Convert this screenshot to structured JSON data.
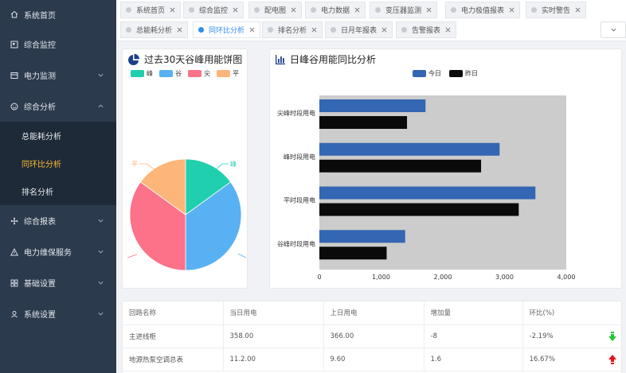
{
  "sidebar": {
    "items": [
      {
        "label": "系统首页",
        "icon": "home-icon"
      },
      {
        "label": "综合监控",
        "icon": "grid-icon"
      },
      {
        "label": "电力监测",
        "icon": "monitor-icon"
      },
      {
        "label": "综合分析",
        "icon": "smile-icon"
      },
      {
        "label": "综合报表",
        "icon": "move-icon"
      },
      {
        "label": "电力维保服务",
        "icon": "warning-icon"
      },
      {
        "label": "基础设置",
        "icon": "apps-icon"
      },
      {
        "label": "系统设置",
        "icon": "user-icon"
      }
    ],
    "sub_items": [
      {
        "label": "总能耗分析"
      },
      {
        "label": "同环比分析"
      },
      {
        "label": "排名分析"
      }
    ]
  },
  "tabs": [
    {
      "label": "系统首页"
    },
    {
      "label": "综合监控"
    },
    {
      "label": "配电图"
    },
    {
      "label": "电力数据"
    },
    {
      "label": "变压器监测"
    },
    {
      "label": "电力极值报表"
    },
    {
      "label": "实时警告"
    },
    {
      "label": "总能耗分析"
    },
    {
      "label": "同环比分析"
    },
    {
      "label": "排名分析"
    },
    {
      "label": "日月年报表"
    },
    {
      "label": "告警报表"
    }
  ],
  "pie_card": {
    "title": "过去30天谷峰用能饼图",
    "legend": [
      {
        "name": "峰",
        "color": "#20cfae"
      },
      {
        "name": "谷",
        "color": "#58b1f2"
      },
      {
        "name": "尖",
        "color": "#fb7289"
      },
      {
        "name": "平",
        "color": "#fdb67a"
      }
    ],
    "labels": {
      "feng": "峰",
      "ping": "平"
    }
  },
  "bar_card": {
    "title": "日峰谷用能同比分析",
    "legend": [
      {
        "name": "今日",
        "color": "#3366b3"
      },
      {
        "name": "昨日",
        "color": "#0a0a0a"
      }
    ]
  },
  "chart_data": [
    {
      "type": "pie",
      "categories": [
        "峰",
        "谷",
        "尖",
        "平"
      ],
      "values": [
        15,
        35,
        35,
        15
      ],
      "colors": [
        "#20cfae",
        "#58b1f2",
        "#fb7289",
        "#fdb67a"
      ]
    },
    {
      "type": "bar",
      "orientation": "horizontal",
      "categories": [
        "尖峰时段用电",
        "峰时段用电",
        "平时段用电",
        "谷峰时段用电"
      ],
      "series": [
        {
          "name": "今日",
          "values": [
            1720,
            2920,
            3500,
            1390
          ],
          "color": "#3366b3"
        },
        {
          "name": "昨日",
          "values": [
            1420,
            2620,
            3230,
            1090
          ],
          "color": "#0a0a0a"
        }
      ],
      "xlim": [
        0,
        4000
      ],
      "xticks": [
        "0",
        "1,000",
        "2,000",
        "3,000",
        "4,000"
      ],
      "plot_bg": "#cccccc"
    }
  ],
  "table": {
    "headers": [
      "回路名称",
      "当日用电",
      "上日用电",
      "增加量",
      "环比(%)"
    ],
    "rows": [
      {
        "cells": [
          "主进线柜",
          "358.00",
          "366.00",
          "-8",
          "-2.19%"
        ],
        "trend": "down",
        "trend_color": "#27c23a"
      },
      {
        "cells": [
          "地源热泵空调总表",
          "11.2.00",
          "9.60",
          "1.6",
          "16.67%"
        ],
        "trend": "up",
        "trend_color": "#e3141b"
      }
    ]
  }
}
